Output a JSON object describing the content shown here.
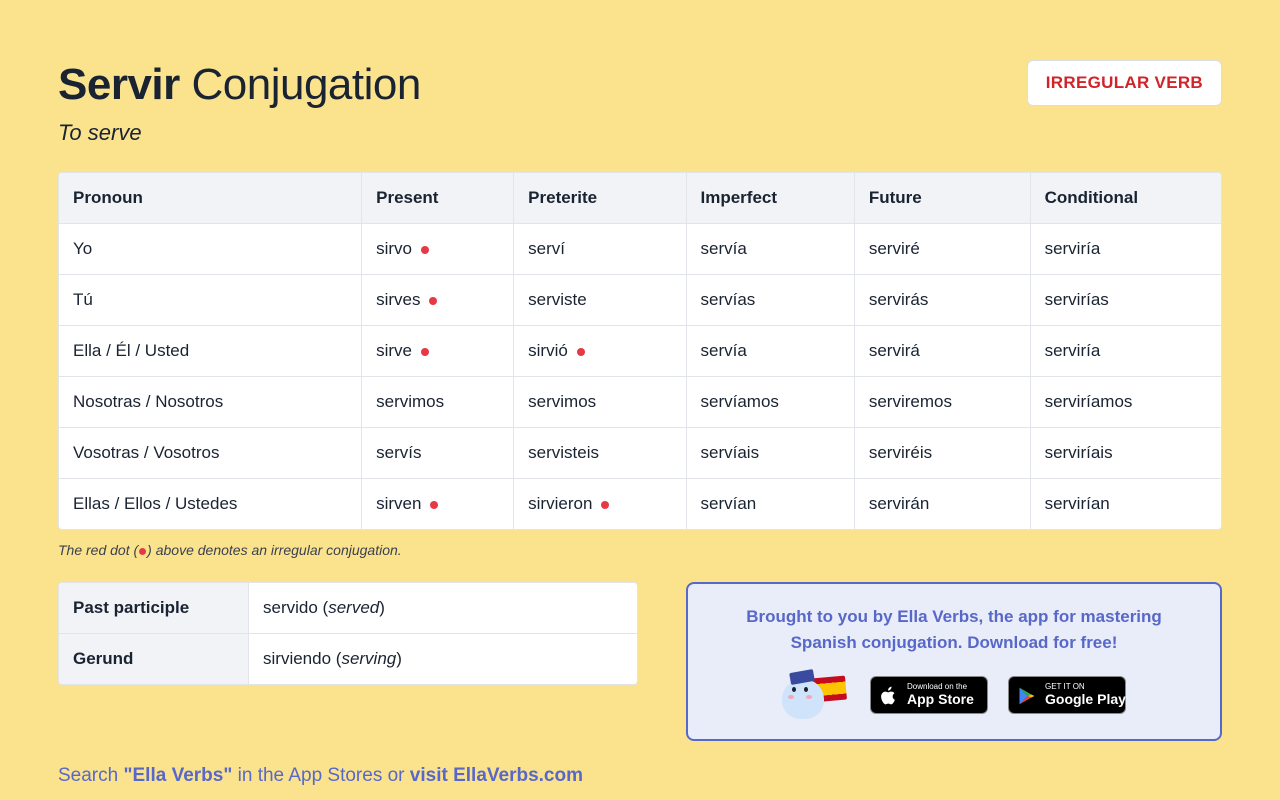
{
  "header": {
    "verb": "Servir",
    "suffix": "Conjugation",
    "meaning": "To serve",
    "badge": "IRREGULAR VERB"
  },
  "columns": [
    "Pronoun",
    "Present",
    "Preterite",
    "Imperfect",
    "Future",
    "Conditional"
  ],
  "rows": [
    {
      "pronoun": "Yo",
      "present": {
        "t": "sirvo",
        "irr": true
      },
      "preterite": {
        "t": "serví",
        "irr": false
      },
      "imperfect": {
        "t": "servía",
        "irr": false
      },
      "future": {
        "t": "serviré",
        "irr": false
      },
      "conditional": {
        "t": "serviría",
        "irr": false
      }
    },
    {
      "pronoun": "Tú",
      "present": {
        "t": "sirves",
        "irr": true
      },
      "preterite": {
        "t": "serviste",
        "irr": false
      },
      "imperfect": {
        "t": "servías",
        "irr": false
      },
      "future": {
        "t": "servirás",
        "irr": false
      },
      "conditional": {
        "t": "servirías",
        "irr": false
      }
    },
    {
      "pronoun": "Ella / Él / Usted",
      "present": {
        "t": "sirve",
        "irr": true
      },
      "preterite": {
        "t": "sirvió",
        "irr": true
      },
      "imperfect": {
        "t": "servía",
        "irr": false
      },
      "future": {
        "t": "servirá",
        "irr": false
      },
      "conditional": {
        "t": "serviría",
        "irr": false
      }
    },
    {
      "pronoun": "Nosotras / Nosotros",
      "present": {
        "t": "servimos",
        "irr": false
      },
      "preterite": {
        "t": "servimos",
        "irr": false
      },
      "imperfect": {
        "t": "servíamos",
        "irr": false
      },
      "future": {
        "t": "serviremos",
        "irr": false
      },
      "conditional": {
        "t": "serviríamos",
        "irr": false
      }
    },
    {
      "pronoun": "Vosotras / Vosotros",
      "present": {
        "t": "servís",
        "irr": false
      },
      "preterite": {
        "t": "servisteis",
        "irr": false
      },
      "imperfect": {
        "t": "servíais",
        "irr": false
      },
      "future": {
        "t": "serviréis",
        "irr": false
      },
      "conditional": {
        "t": "serviríais",
        "irr": false
      }
    },
    {
      "pronoun": "Ellas / Ellos / Ustedes",
      "present": {
        "t": "sirven",
        "irr": true
      },
      "preterite": {
        "t": "sirvieron",
        "irr": true
      },
      "imperfect": {
        "t": "servían",
        "irr": false
      },
      "future": {
        "t": "servirán",
        "irr": false
      },
      "conditional": {
        "t": "servirían",
        "irr": false
      }
    }
  ],
  "note_pre": "The red dot (",
  "note_post": ") above denotes an irregular conjugation.",
  "forms": {
    "pp_label": "Past participle",
    "pp_value": "servido",
    "pp_gloss": "served",
    "ger_label": "Gerund",
    "ger_value": "sirviendo",
    "ger_gloss": "serving"
  },
  "promo": {
    "text": "Brought to you by Ella Verbs, the app for mastering Spanish conjugation. Download for free!",
    "apple_small": "Download on the",
    "apple_big": "App Store",
    "google_small": "GET IT ON",
    "google_big": "Google Play"
  },
  "search_line": {
    "p1": "Search ",
    "p2": "\"Ella Verbs\"",
    "p3": " in the App Stores or ",
    "p4": "visit EllaVerbs.com"
  }
}
